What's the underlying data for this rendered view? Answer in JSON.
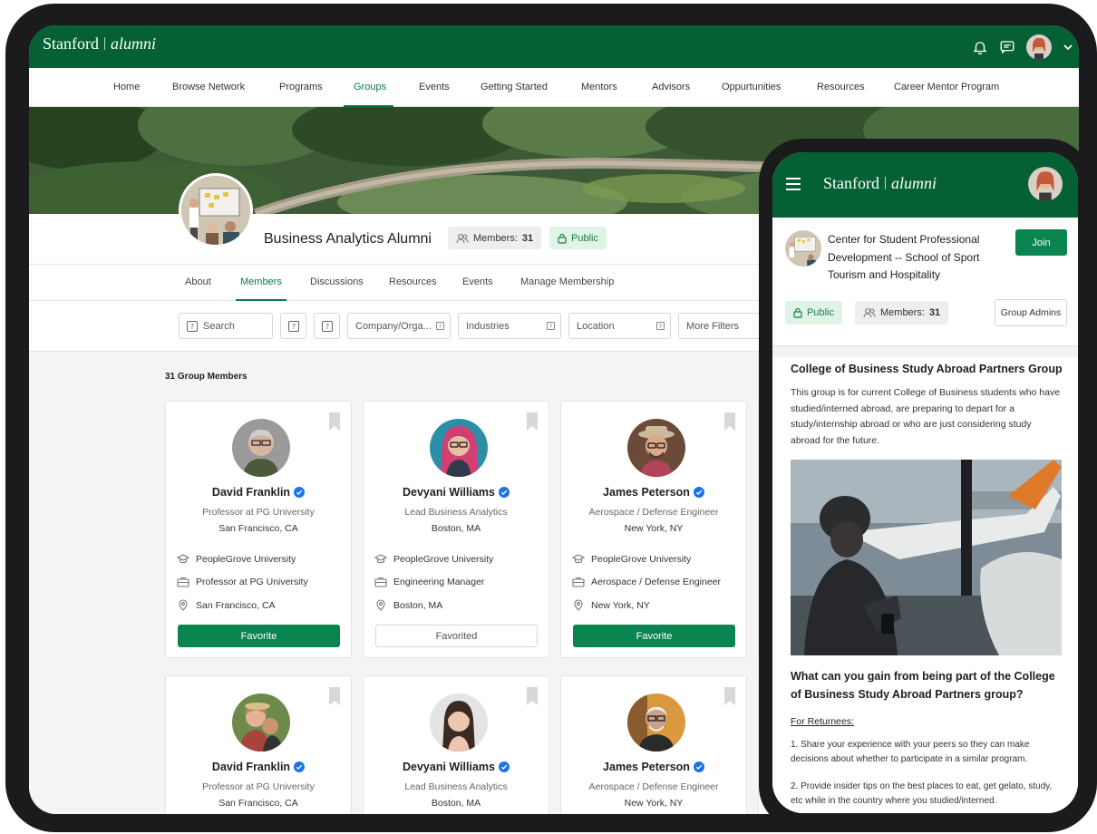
{
  "brand": {
    "name": "Stanford",
    "product": "alumni"
  },
  "colors": {
    "primary": "#056134",
    "accent": "#0a8550",
    "public_chip_bg": "#dff4e6",
    "verified": "#1a73e8"
  },
  "tablet": {
    "nav": {
      "items": [
        "Home",
        "Browse Network",
        "Programs",
        "Groups",
        "Events",
        "Getting Started",
        "Mentors",
        "Advisors",
        "Oppurtunities",
        "Resources",
        "Career Mentor Program"
      ],
      "active": "Groups"
    },
    "group": {
      "title": "Business Analytics Alumni",
      "members_label": "Members:",
      "members_count": "31",
      "visibility": "Public"
    },
    "tabs": {
      "items": [
        "About",
        "Members",
        "Discussions",
        "Resources",
        "Events",
        "Manage Membership"
      ],
      "active": "Members"
    },
    "filters": {
      "search_placeholder": "Search",
      "company": "Company/Orga...",
      "industries": "Industries",
      "location": "Location",
      "more": "More Filters"
    },
    "member_count_label": "31 Group Members",
    "members": [
      {
        "name": "David Franklin",
        "title": "Professor at PG University",
        "location": "San Francisco, CA",
        "school": "PeopleGrove University",
        "job": "Professor at PG University",
        "city": "San Francisco, CA",
        "button": "Favorite"
      },
      {
        "name": "Devyani Williams",
        "title": "Lead Business Analytics",
        "location": "Boston, MA",
        "school": "PeopleGrove University",
        "job": "Engineering Manager",
        "city": "Boston, MA",
        "button": "Favorited"
      },
      {
        "name": "James Peterson",
        "title": "Aerospace / Defense Engineer",
        "location": "New York, NY",
        "school": "PeopleGrove University",
        "job": "Aerospace / Defense Engineer",
        "city": "New York, NY",
        "button": "Favorite"
      },
      {
        "name": "David Franklin",
        "title": "Professor at PG University",
        "location": "San Francisco, CA"
      },
      {
        "name": "Devyani Williams",
        "title": "Lead Business Analytics",
        "location": "Boston, MA"
      },
      {
        "name": "James Peterson",
        "title": "Aerospace / Defense Engineer",
        "location": "New York, NY"
      }
    ]
  },
  "phone": {
    "org_name": "Center for Student Professional Development -- School of Sport Tourism and Hospitality",
    "join": "Join",
    "visibility": "Public",
    "members_label": "Members:",
    "members_count": "31",
    "admins": "Group Admins",
    "heading": "College of Business Study Abroad Partners Group",
    "description": "This group is for current College of Business students who have studied/interned abroad, are preparing to depart for a study/internship abroad or who are just considering study abroad for the future.",
    "question": "What can you gain from being part of the College of Business Study Abroad Partners group?",
    "subheading": "For Returnees:",
    "list": [
      "1.   Share your experience with your peers so they can make decisions about whether to participate in a similar program.",
      "2.   Provide insider tips on the best places to eat, get gelato, study, etc while in the country where you studied/interned."
    ]
  }
}
